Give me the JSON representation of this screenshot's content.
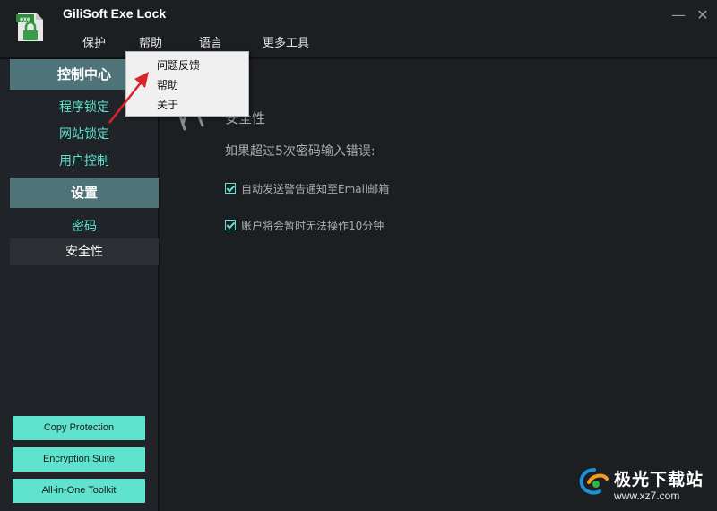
{
  "app": {
    "title": "GiliSoft Exe Lock",
    "icon_text": "exe"
  },
  "window": {
    "minimize_glyph": "—",
    "close_glyph": "✕"
  },
  "menubar": {
    "items": [
      "保护",
      "帮助",
      "语言",
      "更多工具"
    ]
  },
  "help_menu": {
    "items": [
      "问题反馈",
      "帮助",
      "关于"
    ]
  },
  "sidebar": {
    "control_center": {
      "header": "控制中心",
      "items": [
        "程序锁定",
        "网站锁定",
        "用户控制"
      ]
    },
    "settings": {
      "header": "设置",
      "items": [
        "密码",
        "安全性"
      ],
      "active": "安全性"
    },
    "bottom_buttons": [
      "Copy Protection",
      "Encryption  Suite",
      "All-in-One Toolkit"
    ]
  },
  "content": {
    "section_title": "安全性",
    "subtitle": "如果超过5次密码输入错误:",
    "options": [
      {
        "label": "自动发送警告通知至Email邮箱",
        "checked": true
      },
      {
        "label": "账户将会暂时无法操作10分钟",
        "checked": true
      }
    ]
  },
  "watermark": {
    "text": "极光下载站",
    "url": "www.xz7.com"
  },
  "colors": {
    "accent": "#5fe3cf",
    "header_bg": "#4e7379",
    "window_bg": "#1c1f22",
    "arrow": "#d8242a"
  }
}
